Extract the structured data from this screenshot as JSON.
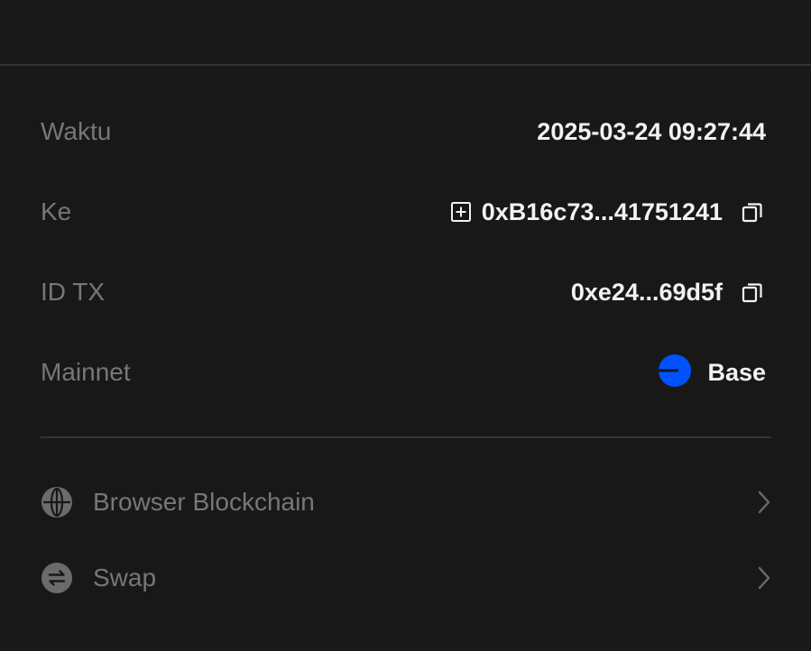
{
  "details": {
    "time": {
      "label": "Waktu",
      "value": "2025-03-24 09:27:44"
    },
    "to": {
      "label": "Ke",
      "value": "0xB16c73...41751241"
    },
    "tx_id": {
      "label": "ID TX",
      "value": "0xe24...69d5f"
    },
    "network": {
      "label": "Mainnet",
      "value": "Base"
    }
  },
  "links": {
    "browser": {
      "label": "Browser Blockchain",
      "icon": "globe-icon"
    },
    "swap": {
      "label": "Swap",
      "icon": "swap-icon"
    }
  },
  "colors": {
    "background": "#181818",
    "divider": "#333333",
    "label": "#777777",
    "value": "#f2f2f2",
    "base_blue": "#0052ff"
  }
}
